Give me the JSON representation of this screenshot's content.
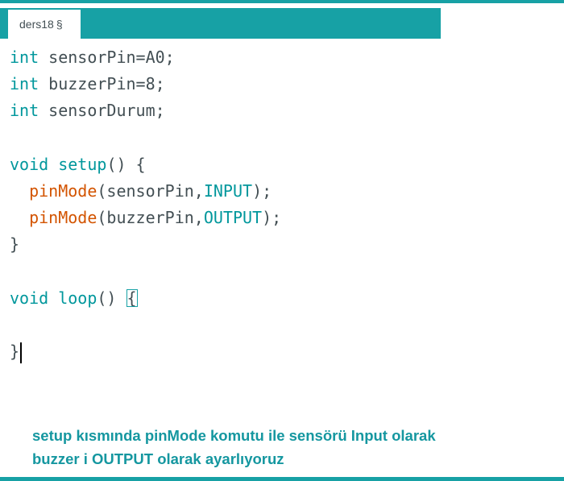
{
  "tab": {
    "name": "ders18",
    "mark": "§"
  },
  "code": {
    "line1": {
      "type": "int",
      "rest": " sensorPin=A0;"
    },
    "line2": {
      "type": "int",
      "rest": " buzzerPin=8;"
    },
    "line3": {
      "type": "int",
      "rest": " sensorDurum;"
    },
    "line5": {
      "type": "void",
      "fn": "setup",
      "rest": "() {"
    },
    "line6": {
      "indent": "  ",
      "fn": "pinMode",
      "open": "(sensorPin,",
      "const": "INPUT",
      "close": ");"
    },
    "line7": {
      "indent": "  ",
      "fn": "pinMode",
      "open": "(buzzerPin,",
      "const": "OUTPUT",
      "close": ");"
    },
    "line8": {
      "text": "}"
    },
    "line10": {
      "type": "void",
      "fn": "loop",
      "rest": "() ",
      "brace": "{"
    },
    "line12": {
      "text": "}"
    }
  },
  "caption": {
    "line1": "setup kısmında pinMode komutu ile sensörü Input olarak",
    "line2": "buzzer i OUTPUT olarak ayarlıyoruz"
  },
  "colors": {
    "accent": "#17a1a5",
    "keyword": "#00979c",
    "function": "#d35400",
    "text": "#434f54",
    "caption": "#1597a0"
  }
}
